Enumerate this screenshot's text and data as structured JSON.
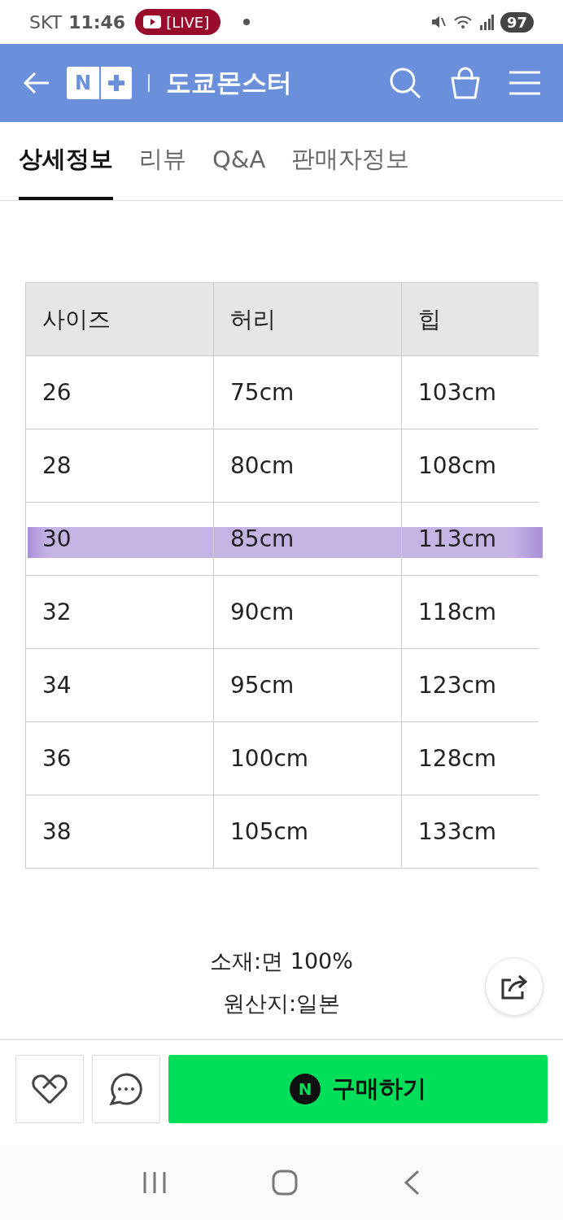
{
  "status_bar": {
    "carrier": "SKT",
    "time": "11:46",
    "live_badge": "[LIVE]",
    "battery": "97"
  },
  "header": {
    "logo_letter": "N",
    "title": "도쿄몬스터"
  },
  "tabs": [
    {
      "label": "상세정보",
      "selected": true
    },
    {
      "label": "리뷰",
      "selected": false
    },
    {
      "label": "Q&A",
      "selected": false
    },
    {
      "label": "판매자정보",
      "selected": false
    }
  ],
  "size_table": {
    "columns": [
      "사이즈",
      "허리",
      "힙"
    ],
    "rows": [
      {
        "cells": [
          "26",
          "75cm",
          "103cm"
        ],
        "highlighted": false
      },
      {
        "cells": [
          "28",
          "80cm",
          "108cm"
        ],
        "highlighted": false
      },
      {
        "cells": [
          "30",
          "85cm",
          "113cm"
        ],
        "highlighted": true
      },
      {
        "cells": [
          "32",
          "90cm",
          "118cm"
        ],
        "highlighted": false
      },
      {
        "cells": [
          "34",
          "95cm",
          "123cm"
        ],
        "highlighted": false
      },
      {
        "cells": [
          "36",
          "100cm",
          "128cm"
        ],
        "highlighted": false
      },
      {
        "cells": [
          "38",
          "105cm",
          "133cm"
        ],
        "highlighted": false
      }
    ]
  },
  "info_lines": [
    "소재:면 100%",
    "원산지:일본"
  ],
  "buy_button": {
    "logo_letter": "N",
    "label": "구매하기"
  }
}
